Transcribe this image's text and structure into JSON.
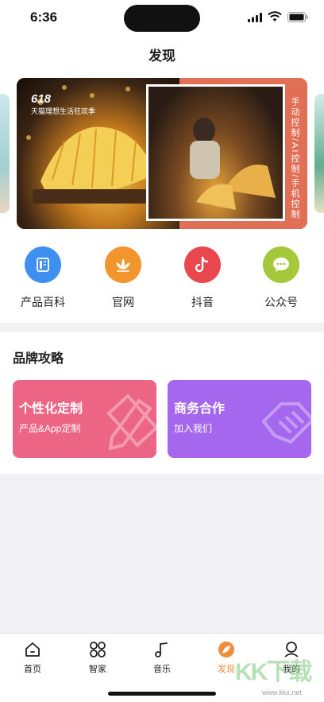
{
  "status": {
    "time": "6:36"
  },
  "page": {
    "title": "发现"
  },
  "banner": {
    "brand_number": "618",
    "brand_text": "天猫理想生活狂欢季",
    "side_text": "手动控制/AI控制/手机控制"
  },
  "quick_links": [
    {
      "label": "产品百科",
      "icon": "book-icon",
      "color": "#3e8ff0"
    },
    {
      "label": "官网",
      "icon": "lotus-icon",
      "color": "#f2952f"
    },
    {
      "label": "抖音",
      "icon": "tiktok-icon",
      "color": "#e8474d"
    },
    {
      "label": "公众号",
      "icon": "wechat-icon",
      "color": "#a3c93a"
    }
  ],
  "brand_section": {
    "title": "品牌攻略",
    "cards": [
      {
        "title": "个性化定制",
        "subtitle": "产品&App定制",
        "color": "#ec6584"
      },
      {
        "title": "商务合作",
        "subtitle": "加入我们",
        "color": "#a667ef"
      }
    ]
  },
  "tabs": [
    {
      "label": "首页",
      "icon": "home-icon"
    },
    {
      "label": "智家",
      "icon": "grid-icon"
    },
    {
      "label": "音乐",
      "icon": "music-note-icon"
    },
    {
      "label": "发现",
      "icon": "discover-leaf-icon",
      "active": true
    },
    {
      "label": "我的",
      "icon": "profile-icon"
    }
  ],
  "watermark": {
    "text": "KK下载",
    "url": "www.kkx.net"
  }
}
